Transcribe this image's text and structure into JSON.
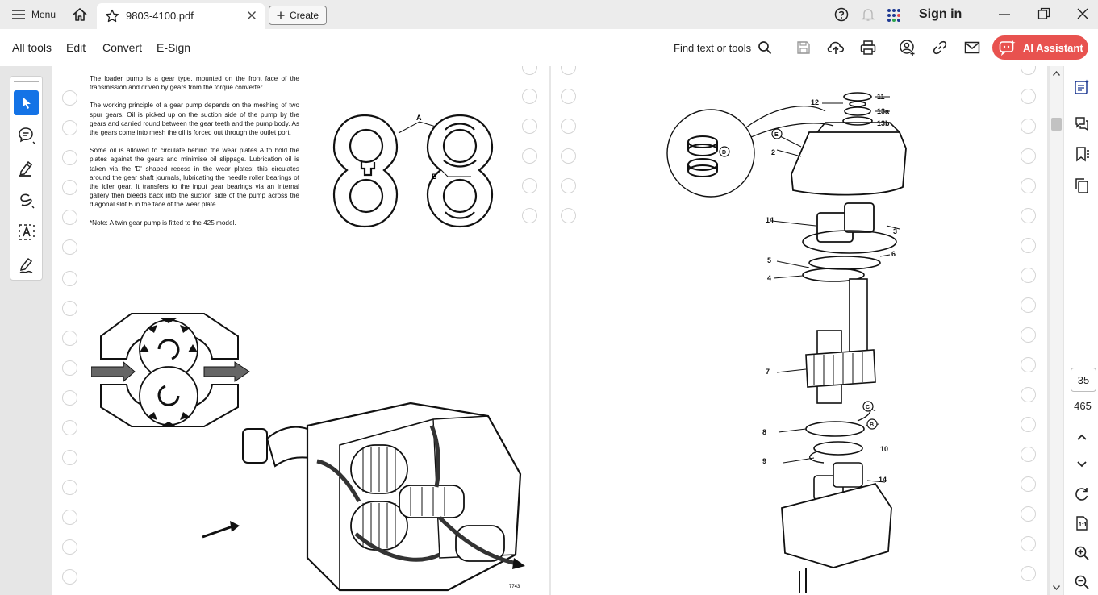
{
  "tabbar": {
    "menu_label": "Menu",
    "tab_title": "9803-4100.pdf",
    "create_label": "Create",
    "sign_in_label": "Sign in"
  },
  "toolbar": {
    "menus": [
      "All tools",
      "Edit",
      "Convert",
      "E-Sign"
    ],
    "find_label": "Find text or tools",
    "ai_label": "AI Assistant"
  },
  "document": {
    "para1": "The loader pump is a gear type, mounted on the front face of the transmission and driven by gears from the torque converter.",
    "para2": "The working principle of a gear pump depends on the meshing of two spur gears. Oil is picked up on the suction side of the pump by the gears and carried round between the gear teeth and the pump body. As the gears come into mesh the oil is forced out through the outlet port.",
    "para3": "Some oil is allowed to circulate behind the wear plates A to hold the plates against the gears and minimise oil slippage. Lubrication oil is taken via the 'D' shaped recess in the wear plates; this circulates around the gear shaft journals, lubricating the needle roller bearings of the idler gear. It transfers to the input gear bearings via an internal gallery then bleeds back into the suction side of the pump across the diagonal slot B in the face of the wear plate.",
    "note": "*Note:  A twin gear pump is fitted to the 425 model.",
    "fig_label_a": "A",
    "fig_label_b": "B",
    "fig_number": "7743",
    "callouts": [
      "11",
      "12",
      "13a",
      "13b",
      "E",
      "2",
      "D",
      "14",
      "3",
      "6",
      "5",
      "4",
      "7",
      "C",
      "B",
      "8",
      "10",
      "9",
      "14"
    ]
  },
  "navigation": {
    "current_page": "35",
    "total_pages": "465"
  }
}
